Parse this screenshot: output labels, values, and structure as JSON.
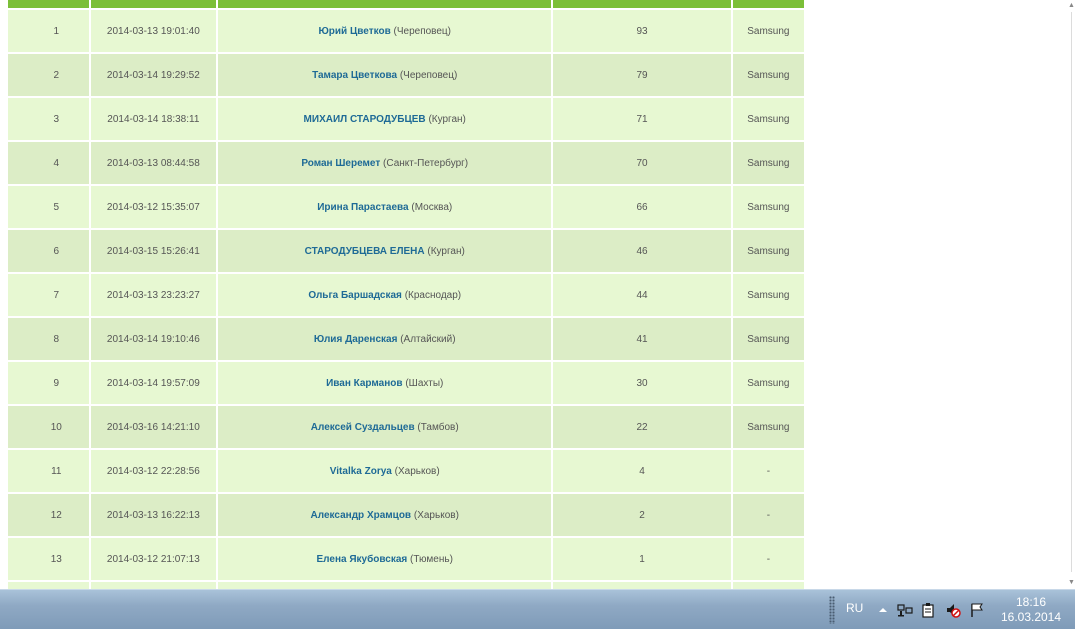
{
  "table": {
    "rows": [
      {
        "num": "1",
        "date": "2014-03-13 19:01:40",
        "name": "Юрий Цветков",
        "city": "(Череповец)",
        "score": "93",
        "prize": "Samsung"
      },
      {
        "num": "2",
        "date": "2014-03-14 19:29:52",
        "name": "Тамара Цветкова",
        "city": "(Череповец)",
        "score": "79",
        "prize": "Samsung"
      },
      {
        "num": "3",
        "date": "2014-03-14 18:38:11",
        "name": "МИХАИЛ СТАРОДУБЦЕВ",
        "city": "(Курган)",
        "score": "71",
        "prize": "Samsung"
      },
      {
        "num": "4",
        "date": "2014-03-13 08:44:58",
        "name": "Роман Шеремет",
        "city": "(Санкт-Петербург)",
        "score": "70",
        "prize": "Samsung"
      },
      {
        "num": "5",
        "date": "2014-03-12 15:35:07",
        "name": "Ирина Парастаева",
        "city": "(Москва)",
        "score": "66",
        "prize": "Samsung"
      },
      {
        "num": "6",
        "date": "2014-03-15 15:26:41",
        "name": "СТАРОДУБЦЕВА ЕЛЕНА",
        "city": "(Курган)",
        "score": "46",
        "prize": "Samsung"
      },
      {
        "num": "7",
        "date": "2014-03-13 23:23:27",
        "name": "Ольга Баршадская",
        "city": "(Краснодар)",
        "score": "44",
        "prize": "Samsung"
      },
      {
        "num": "8",
        "date": "2014-03-14 19:10:46",
        "name": "Юлия Даренская",
        "city": "(Алтайский)",
        "score": "41",
        "prize": "Samsung"
      },
      {
        "num": "9",
        "date": "2014-03-14 19:57:09",
        "name": "Иван Карманов",
        "city": "(Шахты)",
        "score": "30",
        "prize": "Samsung"
      },
      {
        "num": "10",
        "date": "2014-03-16 14:21:10",
        "name": "Алексей Суздальцев",
        "city": "(Тамбов)",
        "score": "22",
        "prize": "Samsung"
      },
      {
        "num": "11",
        "date": "2014-03-12 22:28:56",
        "name": "Vitalka Zorya",
        "city": "(Харьков)",
        "score": "4",
        "prize": "-"
      },
      {
        "num": "12",
        "date": "2014-03-13 16:22:13",
        "name": "Александр Храмцов",
        "city": "(Харьков)",
        "score": "2",
        "prize": "-"
      },
      {
        "num": "13",
        "date": "2014-03-12 21:07:13",
        "name": "Елена Якубовская",
        "city": "(Тюмень)",
        "score": "1",
        "prize": "-"
      }
    ]
  },
  "taskbar": {
    "language": "RU",
    "time": "18:16",
    "date": "16.03.2014",
    "tray_icons": [
      "show-hidden-icons-arrow-icon",
      "network-icon",
      "clipboard-icon",
      "volume-muted-icon",
      "action-center-flag-icon"
    ]
  },
  "colors": {
    "header_green": "#7bbf38",
    "row_light": "#e7f8d2",
    "row_dark": "#dcedc6",
    "link_blue": "#1e6a96"
  }
}
